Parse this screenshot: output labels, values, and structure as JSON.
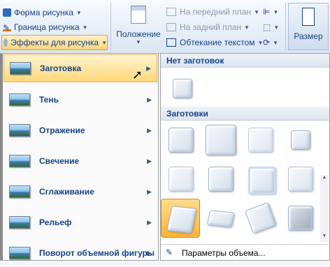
{
  "ribbon": {
    "picture_shape": "Форма рисунка",
    "picture_border": "Граница рисунка",
    "picture_effects": "Эффекты для рисунка",
    "position": "Положение",
    "bring_front": "На передний план",
    "send_back": "На задний план",
    "text_wrap": "Обтекание текстом",
    "size": "Размер"
  },
  "menu": {
    "items": [
      {
        "label": "Заготовка"
      },
      {
        "label": "Тень"
      },
      {
        "label": "Отражение"
      },
      {
        "label": "Свечение"
      },
      {
        "label": "Сглаживание"
      },
      {
        "label": "Рельеф"
      },
      {
        "label": "Поворот объемной фигуры"
      }
    ],
    "selected_index": 0
  },
  "gallery": {
    "no_preset_header": "Нет заготовок",
    "presets_header": "Заготовки",
    "options_label": "Параметры объема...",
    "selected_tile": 8
  }
}
